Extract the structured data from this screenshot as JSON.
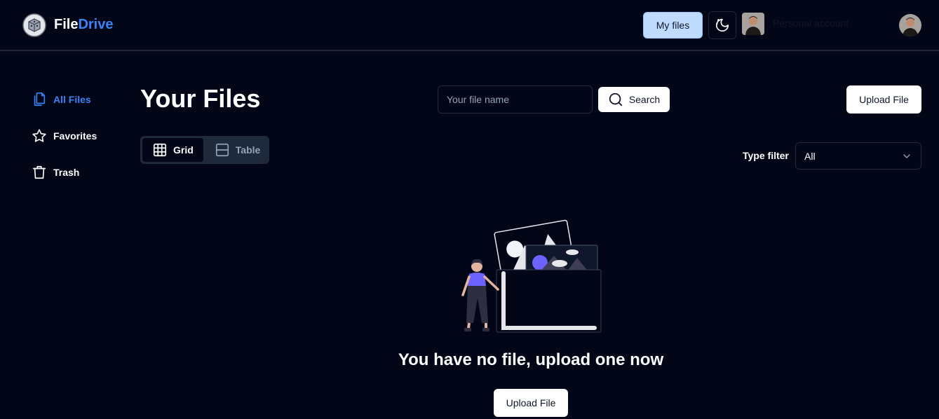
{
  "header": {
    "brand_part1": "File",
    "brand_part2": "Drive",
    "my_files_label": "My files",
    "account_label": "Personal account"
  },
  "sidebar": {
    "items": [
      {
        "label": "All Files",
        "icon": "files-icon",
        "active": true
      },
      {
        "label": "Favorites",
        "icon": "star-icon",
        "active": false
      },
      {
        "label": "Trash",
        "icon": "trash-icon",
        "active": false
      }
    ]
  },
  "main": {
    "title": "Your Files",
    "search": {
      "placeholder": "Your file name",
      "value": "",
      "button_label": "Search"
    },
    "upload_label": "Upload File",
    "view_tabs": [
      {
        "label": "Grid",
        "icon": "grid-icon",
        "active": true
      },
      {
        "label": "Table",
        "icon": "table-icon",
        "active": false
      }
    ],
    "type_filter": {
      "label": "Type filter",
      "selected": "All"
    },
    "empty_state": {
      "message": "You have no file, upload one now",
      "button_label": "Upload File"
    }
  },
  "colors": {
    "background": "#020617",
    "accent": "#3b82f6",
    "border": "#1e293b",
    "my_files_bg": "#bfdbfe"
  }
}
